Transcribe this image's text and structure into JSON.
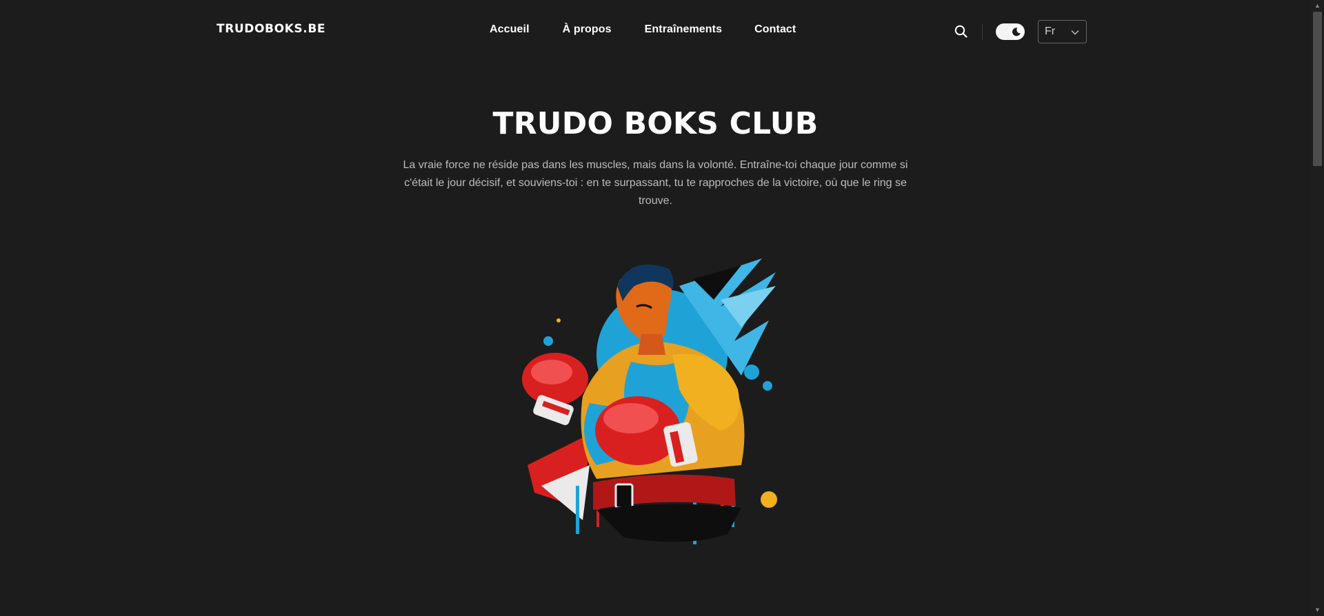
{
  "header": {
    "logo": "TRUDOBOKS.BE",
    "nav": [
      {
        "label": "Accueil"
      },
      {
        "label": "À propos"
      },
      {
        "label": "Entraînements"
      },
      {
        "label": "Contact"
      }
    ],
    "language": {
      "selected": "Fr"
    },
    "icons": {
      "search": "search-icon",
      "theme": "dark-mode-toggle",
      "dropdown": "chevron-down-icon"
    }
  },
  "hero": {
    "title": "TRUDO BOKS CLUB",
    "text": "La vraie force ne réside pas dans les muscles, mais dans la volonté. Entraîne-toi chaque jour comme si c'était le jour décisif, et souviens-toi : en te surpassant, tu te rapproches de la victoire, où que le ring se trouve."
  },
  "colors": {
    "background": "#1c1c1c",
    "text": "#ffffff",
    "muted_text": "#bdbdbd",
    "accent_blue": "#1fa3d6",
    "accent_red": "#d92020",
    "accent_yellow": "#f0b020"
  }
}
